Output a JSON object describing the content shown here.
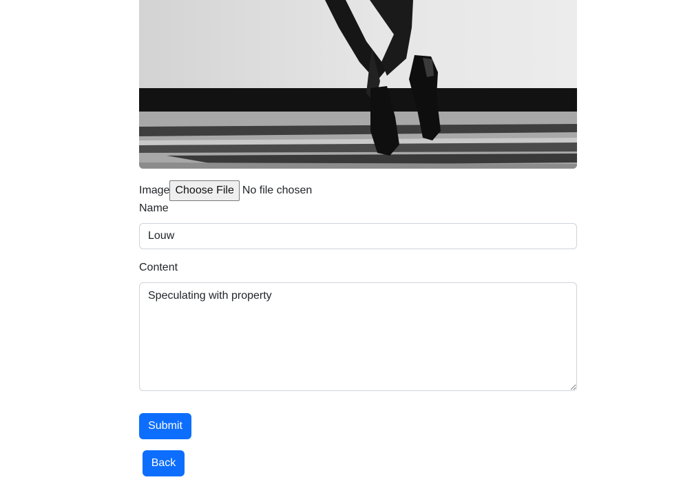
{
  "form": {
    "image_label": "Image",
    "file_button_label": "Choose File",
    "file_status": "No file chosen",
    "name_label": "Name",
    "name_value": "Louw",
    "content_label": "Content",
    "content_value": "Speculating with property",
    "submit_label": "Submit",
    "back_label": "Back"
  },
  "colors": {
    "primary": "#0d6efd",
    "input_border": "#ced4da"
  }
}
